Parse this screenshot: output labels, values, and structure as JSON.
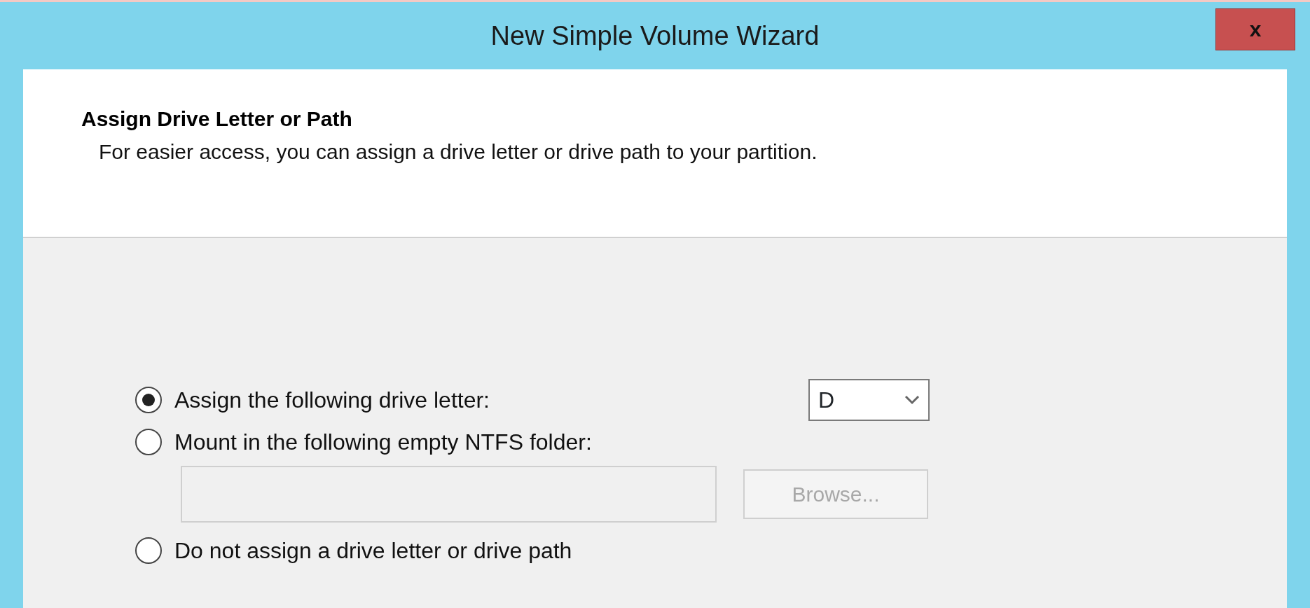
{
  "window": {
    "title": "New Simple Volume Wizard",
    "close": "x"
  },
  "header": {
    "title": "Assign Drive Letter or Path",
    "subtitle": "For easier access, you can assign a drive letter or drive path to your partition."
  },
  "options": [
    {
      "kind": "letter",
      "label": "Assign the following drive letter:",
      "selected": true,
      "value": "D"
    },
    {
      "kind": "folder",
      "label": "Mount in the following empty NTFS folder:",
      "selected": false,
      "disabled": true,
      "button": "Browse..."
    },
    {
      "kind": "none",
      "label": "Do not assign a drive letter or drive path",
      "selected": false
    }
  ]
}
